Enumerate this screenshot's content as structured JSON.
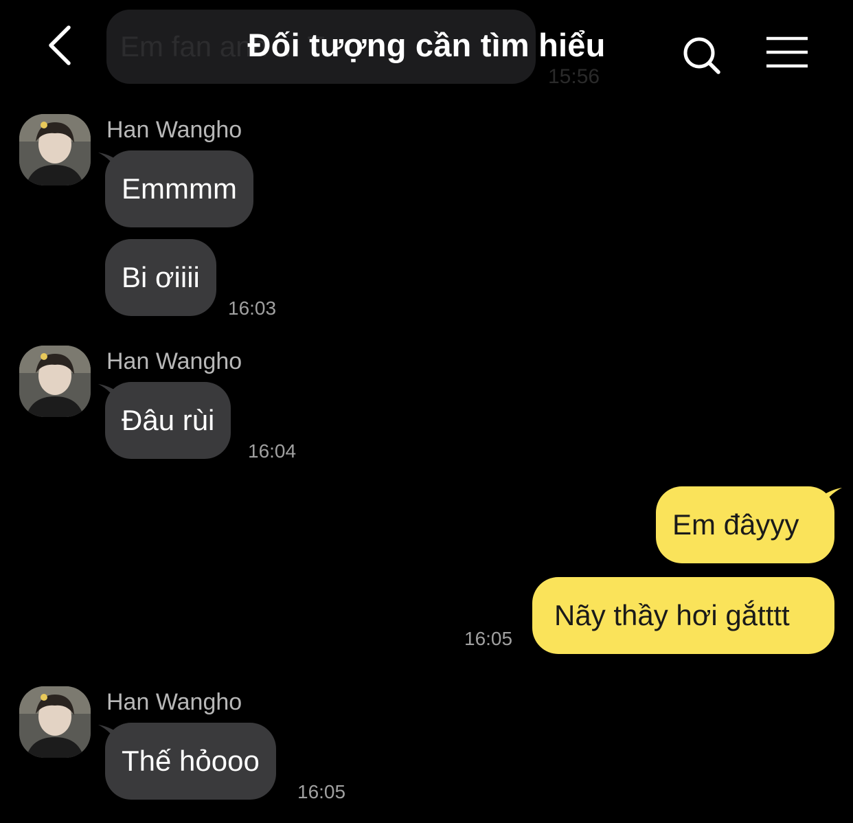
{
  "background_message": {
    "text": "Em fan anh ... T",
    "time": "15:56"
  },
  "header": {
    "title": "Đối tượng cần tìm hiểu",
    "back_icon": "chevron-left-icon",
    "search_icon": "search-icon",
    "menu_icon": "hamburger-menu-icon"
  },
  "colors": {
    "background": "#000000",
    "incoming_bubble": "#3a3a3c",
    "outgoing_bubble": "#fae35a",
    "timestamp": "#a0a0a0",
    "sender_name": "#b8b8b8"
  },
  "messages": [
    {
      "sender": "Han Wangho",
      "direction": "incoming",
      "bubbles": [
        "Emmmm",
        "Bi ơiiii"
      ],
      "time": "16:03"
    },
    {
      "sender": "Han Wangho",
      "direction": "incoming",
      "bubbles": [
        "Đâu rùi"
      ],
      "time": "16:04"
    },
    {
      "sender": "",
      "direction": "outgoing",
      "bubbles": [
        "Em đâyyy",
        "Nãy thầy hơi gắtttt"
      ],
      "time": "16:05"
    },
    {
      "sender": "Han Wangho",
      "direction": "incoming",
      "bubbles": [
        "Thế hỏooo"
      ],
      "time": "16:05"
    }
  ]
}
